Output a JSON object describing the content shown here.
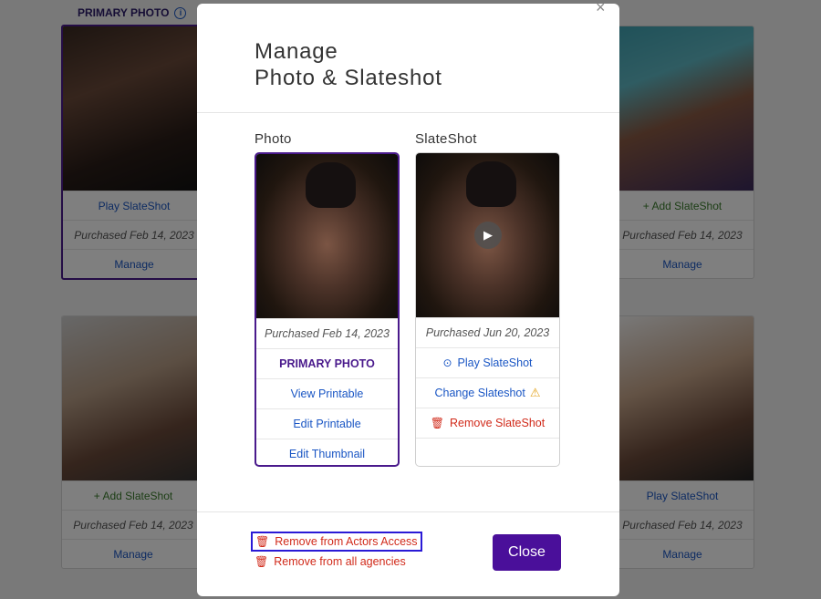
{
  "background": {
    "primary_label": "PRIMARY PHOTO",
    "info_icon": "info-icon",
    "cards": [
      {
        "rows": [
          "Play SlateShot",
          "Purchased Feb 14, 2023",
          "Manage"
        ]
      },
      {
        "rows": [
          "+ Add SlateShot",
          "Purchased Feb 14, 2023",
          "Manage"
        ]
      },
      {
        "rows": [
          "+ Add SlateShot",
          "Purchased Feb 14, 2023",
          "Manage"
        ]
      },
      {
        "rows": [
          "Play SlateShot",
          "Purchased Feb 14, 2023",
          "Manage"
        ]
      }
    ]
  },
  "modal": {
    "title_line1": "Manage",
    "title_line2": "Photo & Slateshot",
    "close_x": "×",
    "photo": {
      "heading": "Photo",
      "purchased": "Purchased Feb 14, 2023",
      "primary": "PRIMARY PHOTO",
      "view_printable": "View Printable",
      "edit_printable": "Edit Printable",
      "edit_thumbnail": "Edit Thumbnail"
    },
    "slateshot": {
      "heading": "SlateShot",
      "purchased": "Purchased Jun 20, 2023",
      "play": "Play SlateShot",
      "change": "Change Slateshot",
      "remove": "Remove SlateShot"
    },
    "footer": {
      "remove_actors_access": "Remove from Actors Access",
      "remove_all_agencies": "Remove from all agencies",
      "close": "Close"
    }
  },
  "colors": {
    "accent": "#4a0f9a",
    "link": "#1a56c4",
    "danger": "#d12a1a",
    "warning": "#e3a21a"
  }
}
